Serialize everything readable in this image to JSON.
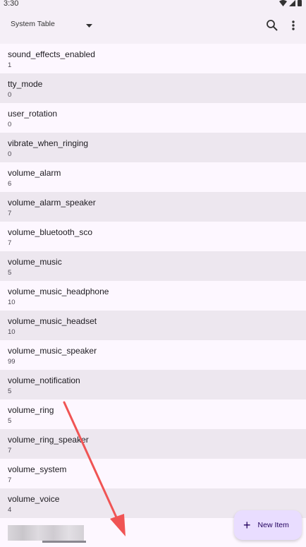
{
  "status_bar": {
    "time": "3:30"
  },
  "app_bar": {
    "table_name": "System Table"
  },
  "settings": [
    {
      "key": "sound_effects_enabled",
      "value": "1"
    },
    {
      "key": "tty_mode",
      "value": "0"
    },
    {
      "key": "user_rotation",
      "value": "0"
    },
    {
      "key": "vibrate_when_ringing",
      "value": "0"
    },
    {
      "key": "volume_alarm",
      "value": "6"
    },
    {
      "key": "volume_alarm_speaker",
      "value": "7"
    },
    {
      "key": "volume_bluetooth_sco",
      "value": "7"
    },
    {
      "key": "volume_music",
      "value": "5"
    },
    {
      "key": "volume_music_headphone",
      "value": "10"
    },
    {
      "key": "volume_music_headset",
      "value": "10"
    },
    {
      "key": "volume_music_speaker",
      "value": "99"
    },
    {
      "key": "volume_notification",
      "value": "5"
    },
    {
      "key": "volume_ring",
      "value": "5"
    },
    {
      "key": "volume_ring_speaker",
      "value": "7"
    },
    {
      "key": "volume_system",
      "value": "7"
    },
    {
      "key": "volume_voice",
      "value": "4"
    }
  ],
  "fab": {
    "label": "New Item"
  },
  "colors": {
    "accent": "#e9ddff",
    "row_alt": "#ede7ef",
    "background": "#fdf7ff",
    "annotation_arrow": "#f05454"
  }
}
